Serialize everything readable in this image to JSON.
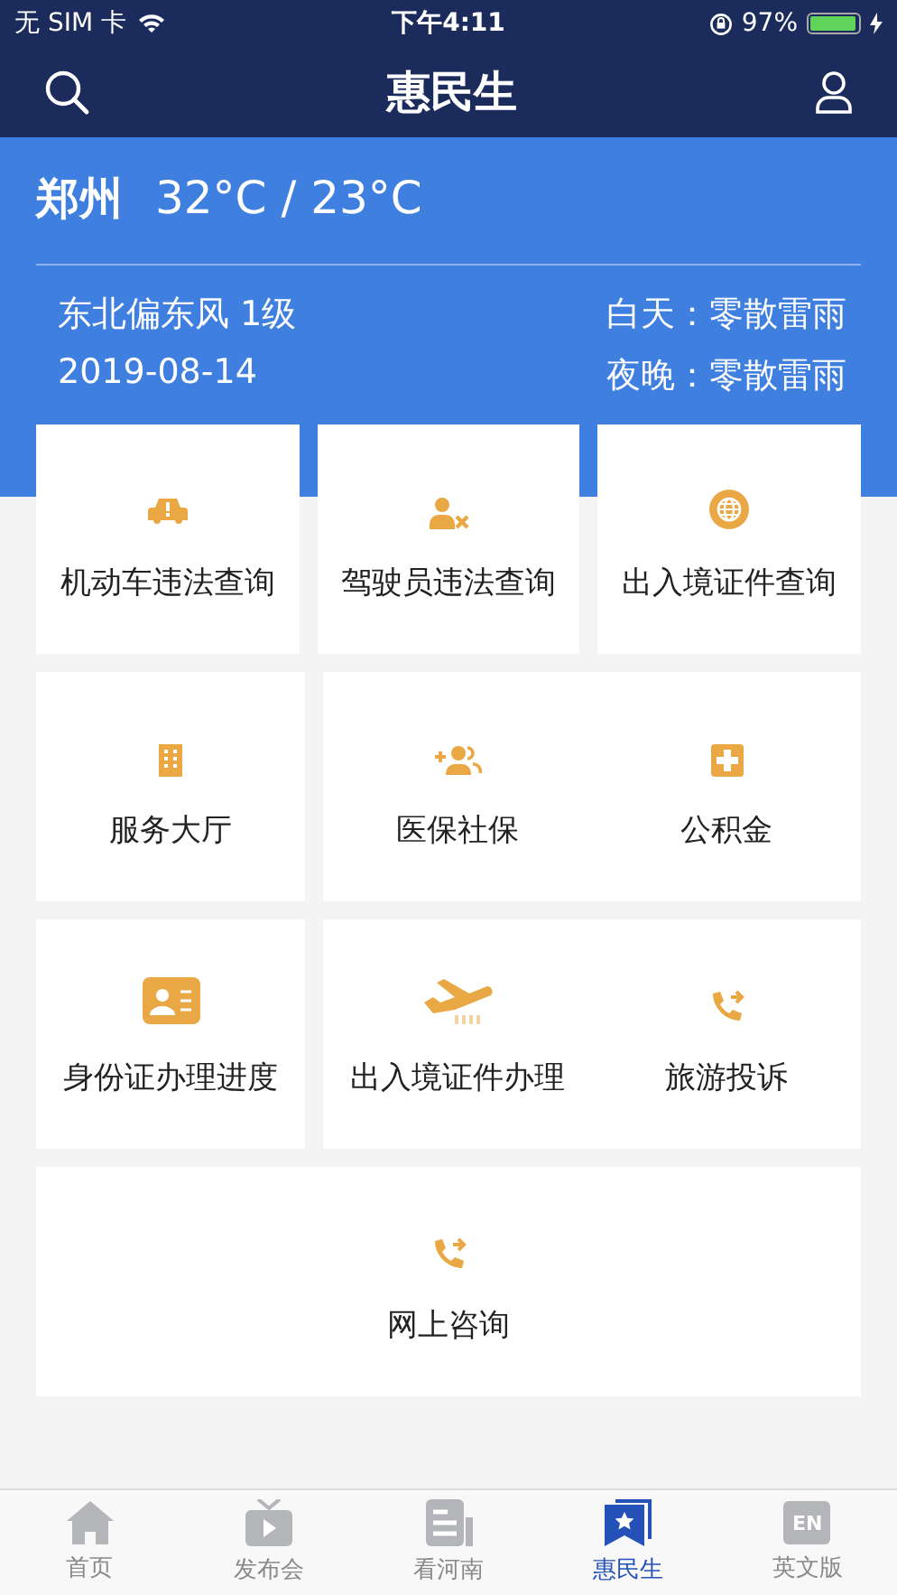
{
  "status_bar": {
    "carrier": "无 SIM 卡",
    "time": "下午4:11",
    "battery": "97%",
    "battery_meter": {
      "level": 0.97
    }
  },
  "nav": {
    "title": "惠民生"
  },
  "weather": {
    "city": "郑州",
    "temperature": "32°C / 23°C",
    "wind": "东北偏东风 1级",
    "date": "2019-08-14",
    "day": "白天：零散雷雨",
    "night": "夜晚：零散雷雨"
  },
  "rows": [
    {
      "cards": [
        {
          "items": [
            {
              "kind": "car",
              "label": "机动车违法查询"
            }
          ]
        },
        {
          "items": [
            {
              "kind": "driver",
              "label": "驾驶员违法查询"
            }
          ]
        },
        {
          "items": [
            {
              "kind": "globe",
              "label": "出入境证件查询"
            }
          ]
        }
      ]
    },
    {
      "cards": [
        {
          "items": [
            {
              "kind": "building",
              "label": "服务大厅"
            }
          ]
        },
        {
          "items": [
            {
              "kind": "people",
              "label": "医保社保"
            },
            {
              "kind": "fund",
              "label": "公积金"
            }
          ]
        }
      ]
    },
    {
      "cards": [
        {
          "items": [
            {
              "kind": "idcard",
              "label": "身份证办理进度"
            }
          ]
        },
        {
          "items": [
            {
              "kind": "plane",
              "label": "出入境证件办理"
            },
            {
              "kind": "phone",
              "label": "旅游投诉"
            }
          ]
        }
      ]
    },
    {
      "cards": [
        {
          "items": [
            {
              "kind": "phone",
              "label": "网上咨询"
            }
          ]
        }
      ]
    }
  ],
  "tabs": [
    {
      "kind": "home",
      "label": "首页",
      "selected": false
    },
    {
      "kind": "tv",
      "label": "发布会",
      "selected": false
    },
    {
      "kind": "news",
      "label": "看河南",
      "selected": false
    },
    {
      "kind": "star",
      "label": "惠民生",
      "selected": true
    },
    {
      "kind": "en",
      "label": "英文版",
      "icon_text": "EN",
      "selected": false
    }
  ]
}
